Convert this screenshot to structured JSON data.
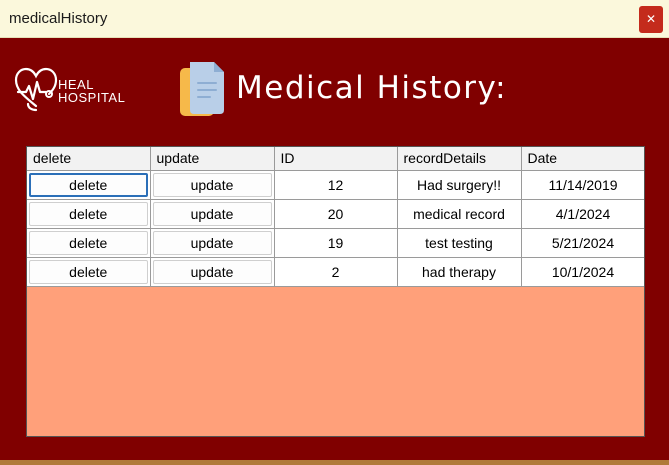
{
  "window": {
    "title": "medicalHistory",
    "close_glyph": "✕"
  },
  "logo": {
    "line1": "HEAL",
    "line2": "HOSPITAL",
    "icon": "heart-pulse-icon"
  },
  "header": {
    "title": "Medical History:",
    "icon": "document-icon"
  },
  "grid": {
    "columns": [
      "delete",
      "update",
      "ID",
      "recordDetails",
      "Date"
    ],
    "rows": [
      {
        "delete": "delete",
        "update": "update",
        "id": "12",
        "details": "Had surgery!!",
        "date": "11/14/2019"
      },
      {
        "delete": "delete",
        "update": "update",
        "id": "20",
        "details": "medical record",
        "date": "4/1/2024"
      },
      {
        "delete": "delete",
        "update": "update",
        "id": "19",
        "details": "test testing",
        "date": "5/21/2024"
      },
      {
        "delete": "delete",
        "update": "update",
        "id": "2",
        "details": "had therapy",
        "date": "10/1/2024"
      }
    ]
  },
  "colors": {
    "background": "#800000",
    "grid_empty": "#ffa07a",
    "titlebar": "#fbf8dc",
    "close": "#c42b1c"
  }
}
